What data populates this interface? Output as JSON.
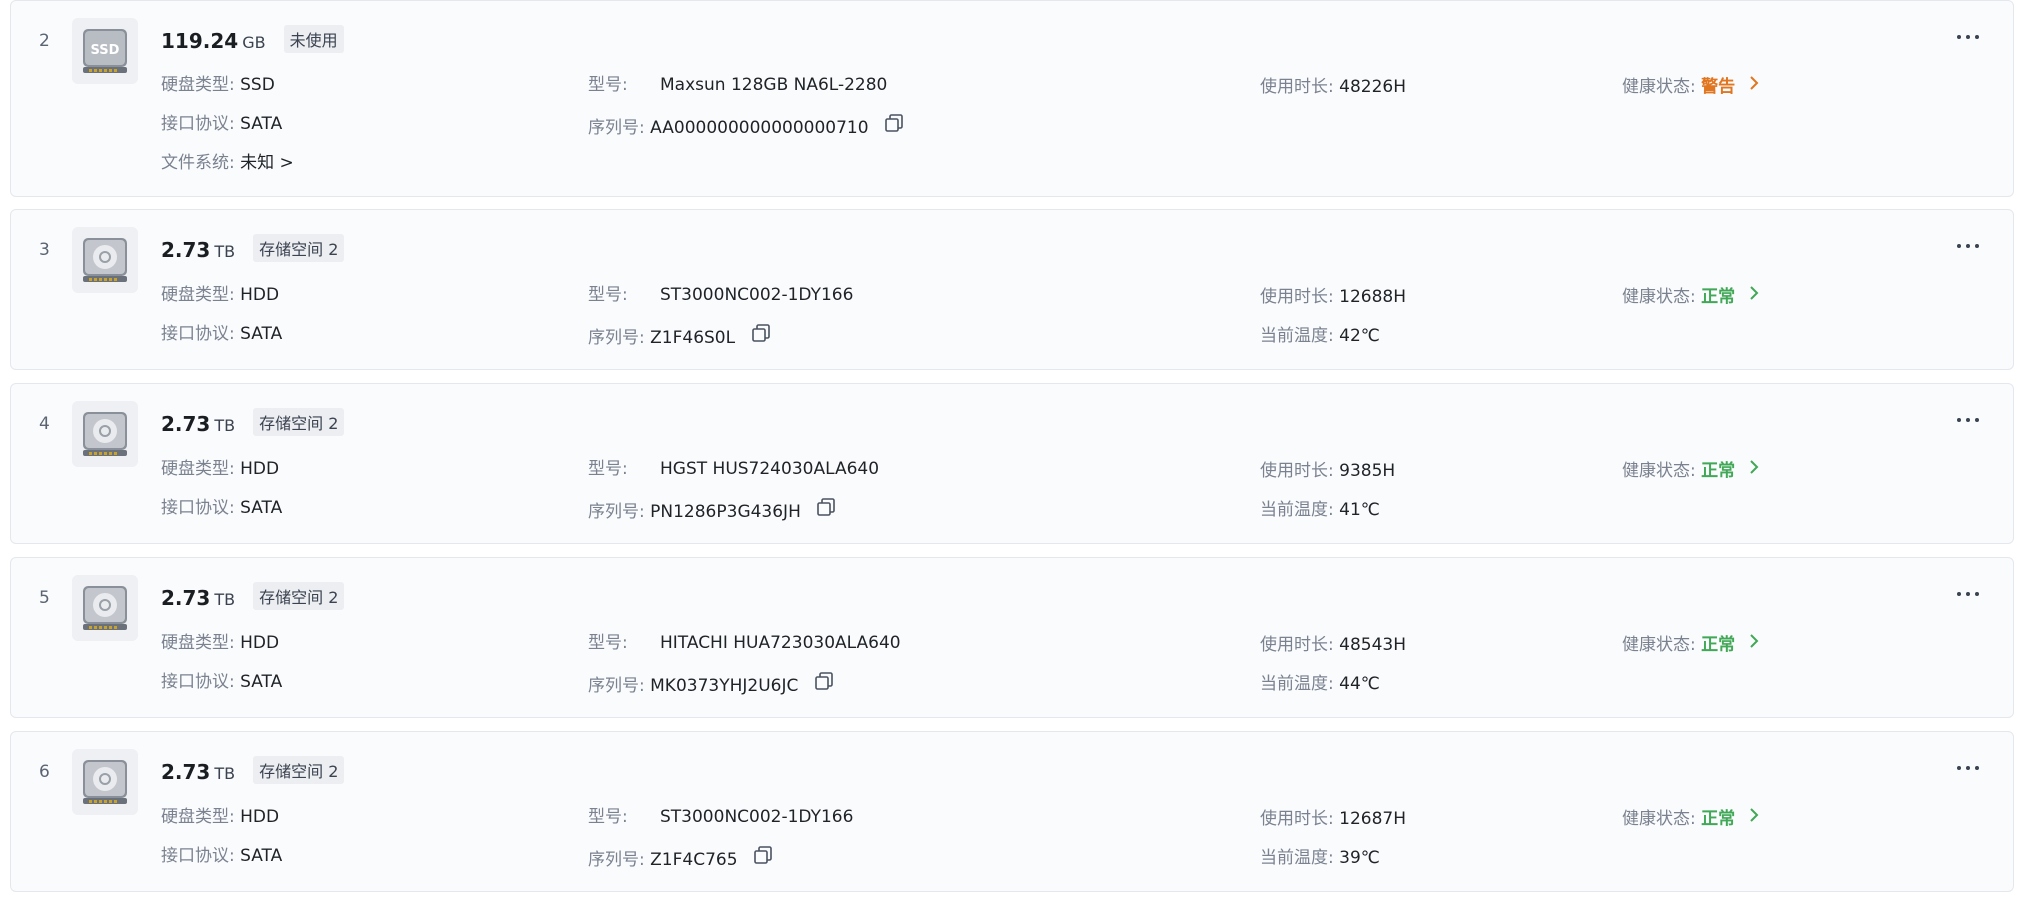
{
  "labels": {
    "type": "硬盘类型:",
    "protocol": "接口协议:",
    "filesystem": "文件系统:",
    "model": "型号:",
    "serial": "序列号:",
    "hours": "使用时长:",
    "temp": "当前温度:",
    "health": "健康状态:"
  },
  "disks": [
    {
      "index": "2",
      "icon": "ssd-drive-icon",
      "capacity": "119.24",
      "unit": "GB",
      "tag": "未使用",
      "type": "SSD",
      "protocol": "SATA",
      "filesystem": "未知 >",
      "model": "Maxsun 128GB NA6L-2280",
      "serial": "AA000000000000000710",
      "hours": "48226H",
      "health": "警告",
      "health_color": "#e0761f"
    },
    {
      "index": "3",
      "icon": "hdd-drive-icon",
      "capacity": "2.73",
      "unit": "TB",
      "tag": "存储空间 2",
      "type": "HDD",
      "protocol": "SATA",
      "model": "ST3000NC002-1DY166",
      "serial": "Z1F46S0L",
      "hours": "12688H",
      "temp": "42℃",
      "health": "正常",
      "health_color": "#41a857"
    },
    {
      "index": "4",
      "icon": "hdd-drive-icon",
      "capacity": "2.73",
      "unit": "TB",
      "tag": "存储空间 2",
      "type": "HDD",
      "protocol": "SATA",
      "model": "HGST HUS724030ALA640",
      "serial": "PN1286P3G436JH",
      "hours": "9385H",
      "temp": "41℃",
      "health": "正常",
      "health_color": "#41a857"
    },
    {
      "index": "5",
      "icon": "hdd-drive-icon",
      "capacity": "2.73",
      "unit": "TB",
      "tag": "存储空间 2",
      "type": "HDD",
      "protocol": "SATA",
      "model": "HITACHI HUA723030ALA640",
      "serial": "MK0373YHJ2U6JC",
      "hours": "48543H",
      "temp": "44℃",
      "health": "正常",
      "health_color": "#41a857"
    },
    {
      "index": "6",
      "icon": "hdd-drive-icon",
      "capacity": "2.73",
      "unit": "TB",
      "tag": "存储空间 2",
      "type": "HDD",
      "protocol": "SATA",
      "model": "ST3000NC002-1DY166",
      "serial": "Z1F4C765",
      "hours": "12687H",
      "temp": "39℃",
      "health": "正常",
      "health_color": "#41a857"
    }
  ]
}
